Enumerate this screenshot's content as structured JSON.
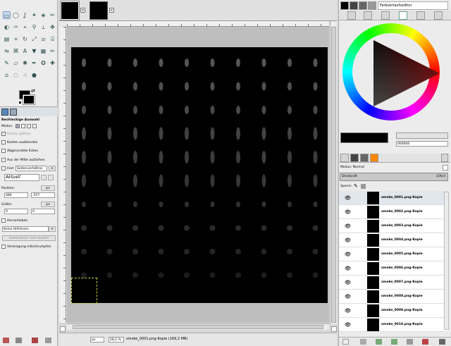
{
  "toolbox": {
    "tools": [
      "rect-select",
      "ellipse-select",
      "free-select",
      "fuzzy-select",
      "select-by-color",
      "scissors",
      "foreground-select",
      "paths",
      "color-picker",
      "zoom",
      "measure",
      "move",
      "align",
      "crop",
      "rotate",
      "scale",
      "shear",
      "perspective",
      "flip",
      "cage",
      "text",
      "bucket-fill",
      "blend",
      "pencil",
      "paintbrush",
      "eraser",
      "airbrush",
      "ink",
      "clone",
      "heal",
      "perspective-clone",
      "blur",
      "smudge",
      "dodge-burn"
    ],
    "options_title": "Rechteckige Auswahl",
    "modus_label": "Modus:",
    "kanten_glaetten": "Kanten glätten",
    "kanten_ausblenden": "Kanten ausblenden",
    "abgerundete_ecken": "Abgerundete Ecken",
    "aus_der_mitte": "Aus der Mitte aufziehen",
    "fest_label": "Fest",
    "fest_value": "Seitenverhältnis",
    "aktuell": "Aktuell",
    "position_label": "Position:",
    "position_unit": "px",
    "pos_x": "486",
    "pos_y": "-557",
    "groesse_label": "Größe:",
    "groesse_unit": "px",
    "size_w": "0",
    "size_h": "0",
    "hervorheben": "Hervorheben",
    "keine_hilfslinien": "Keine Hilfslinien",
    "automatisch_schrumpfen": "Automatisch schrumpfen",
    "vereinigung": "Vereinigung mitschrumpfen"
  },
  "image_window": {
    "tabs": [
      "smoke-tab-1",
      "smoke-tab-2"
    ],
    "close_glyph": "×",
    "unit": "px",
    "zoom": "18,2 %",
    "status_text": "smoke_0001.png-Kopie (169,2 MB)"
  },
  "dock": {
    "panel_title": "Farbverlaufseditor",
    "hex_value": "000000",
    "mode_label": "Modus:",
    "mode_value": "Normal",
    "opacity_label": "Deckkraft",
    "opacity_value": "100,0",
    "lock_label": "Sperre:",
    "layers": [
      "smoke_0001.png-Kopie",
      "smoke_0002.png-Kopie",
      "smoke_0003.png-Kopie",
      "smoke_0004.png-Kopie",
      "smoke_0005.png-Kopie",
      "smoke_0006.png-Kopie",
      "smoke_0007.png-Kopie",
      "smoke_0008.png-Kopie",
      "smoke_0009.png-Kopie",
      "smoke_0010.png-Kopie"
    ]
  }
}
